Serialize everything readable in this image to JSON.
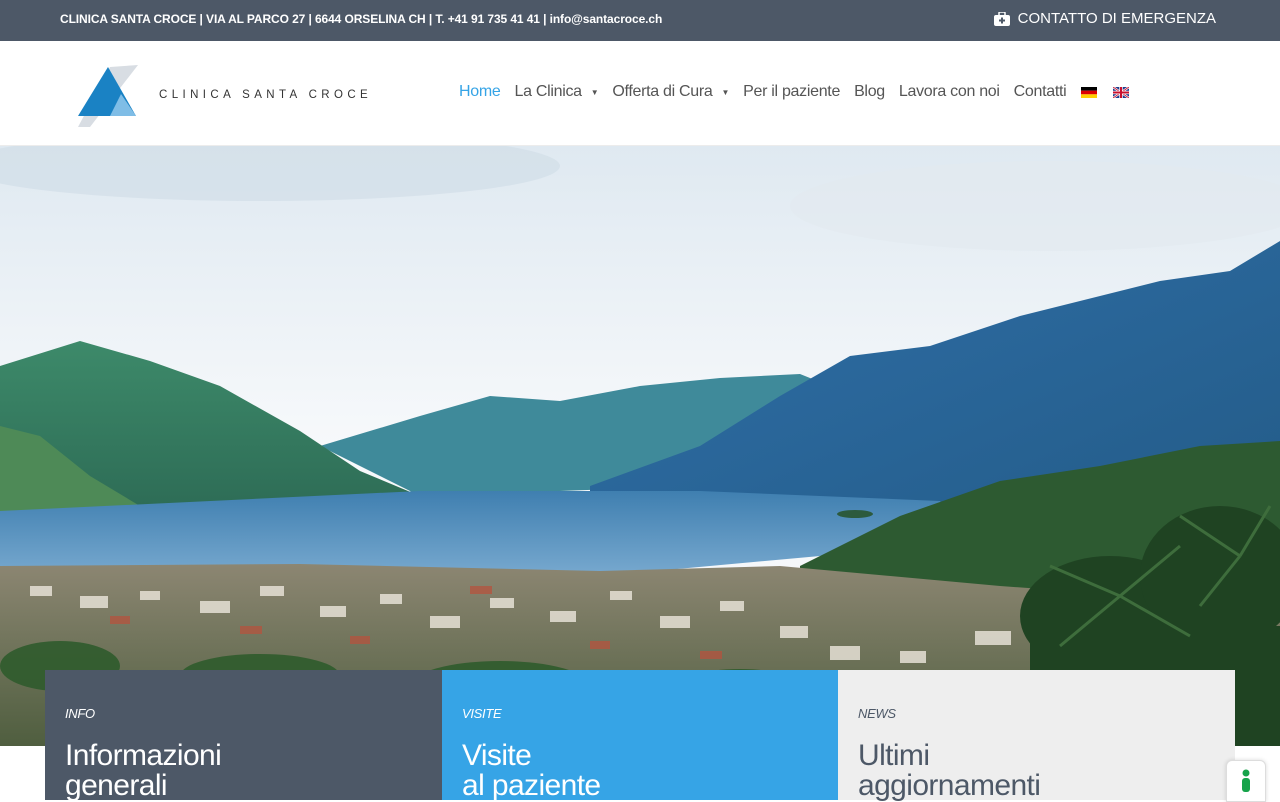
{
  "topbar": {
    "contact_line": "CLINICA SANTA CROCE | VIA AL PARCO 27 | 6644 ORSELINA CH | T. +41 91 735 41 41 | info@santacroce.ch",
    "emergency_label": "CONTATTO DI EMERGENZA",
    "emergency_icon": "medical-kit-icon"
  },
  "logo": {
    "text": "CLINICA SANTA CROCE"
  },
  "nav": {
    "items": [
      {
        "label": "Home",
        "active": true
      },
      {
        "label": "La Clinica",
        "dropdown": true
      },
      {
        "label": "Offerta di Cura",
        "dropdown": true
      },
      {
        "label": "Per il paziente"
      },
      {
        "label": "Blog"
      },
      {
        "label": "Lavora con noi"
      },
      {
        "label": "Contatti"
      }
    ],
    "languages": [
      "german-flag-icon",
      "english-flag-icon"
    ]
  },
  "cards": [
    {
      "kicker": "INFO",
      "title_line1": "Informazioni",
      "title_line2": "generali"
    },
    {
      "kicker": "VISITE",
      "title_line1": "Visite",
      "title_line2": "al paziente"
    },
    {
      "kicker": "NEWS",
      "title_line1": "Ultimi",
      "title_line2": "aggiornamenti"
    }
  ],
  "colors": {
    "topbar": "#4d5867",
    "accent": "#36a4e6",
    "card_news": "#eeeeee"
  }
}
